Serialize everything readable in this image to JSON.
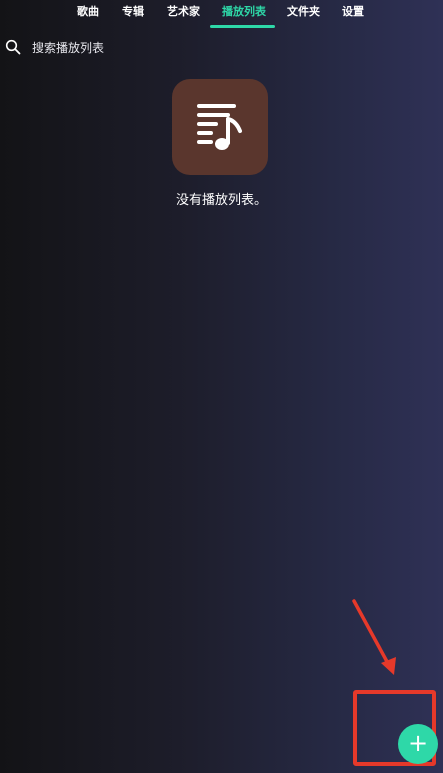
{
  "tabs": [
    {
      "label": "歌曲",
      "active": false
    },
    {
      "label": "专辑",
      "active": false
    },
    {
      "label": "艺术家",
      "active": false
    },
    {
      "label": "播放列表",
      "active": true
    },
    {
      "label": "文件夹",
      "active": false
    },
    {
      "label": "设置",
      "active": false
    }
  ],
  "search": {
    "placeholder": "搜索播放列表",
    "value": "",
    "icon": "search-icon"
  },
  "empty_state": {
    "icon": "playlist-music-icon",
    "message": "没有播放列表。"
  },
  "fab": {
    "label": "+",
    "icon": "plus-icon"
  },
  "colors": {
    "accent": "#2ed8a8",
    "tile": "#5a362d",
    "annotation": "#e6392a",
    "background_left": "#131316",
    "background_right": "#2f3156"
  }
}
